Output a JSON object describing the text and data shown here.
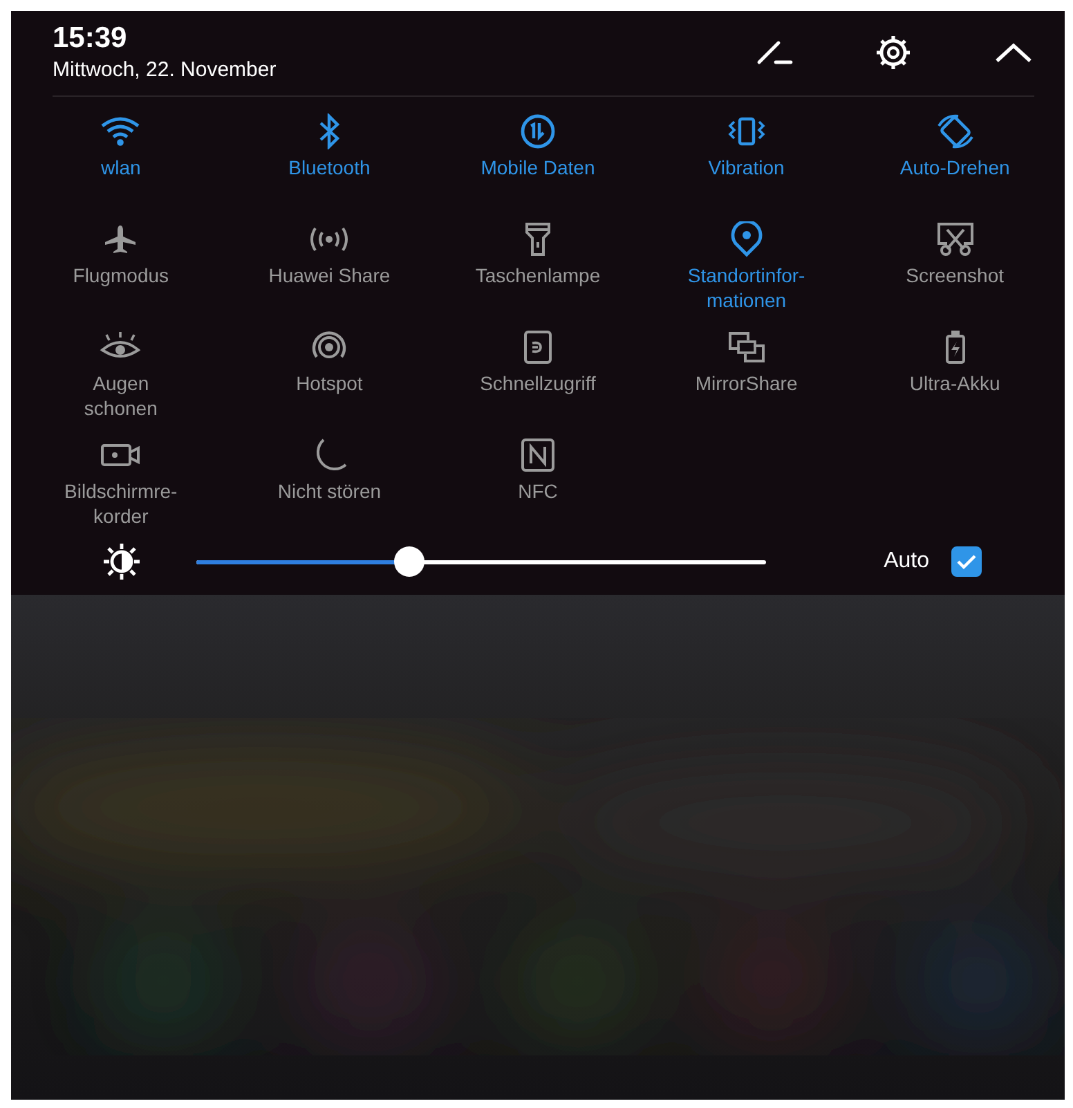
{
  "header": {
    "time": "15:39",
    "date": "Mittwoch, 22. November"
  },
  "tiles": [
    {
      "kind": "wifi",
      "label": "wlan",
      "on": true
    },
    {
      "kind": "bluetooth",
      "label": "Bluetooth",
      "on": true
    },
    {
      "kind": "data",
      "label": "Mobile Daten",
      "on": true
    },
    {
      "kind": "vibration",
      "label": "Vibration",
      "on": true
    },
    {
      "kind": "rotate",
      "label": "Auto-Drehen",
      "on": true
    },
    {
      "kind": "airplane",
      "label": "Flugmodus",
      "on": false
    },
    {
      "kind": "share",
      "label": "Huawei Share",
      "on": false
    },
    {
      "kind": "flashlight",
      "label": "Taschenlampe",
      "on": false
    },
    {
      "kind": "location",
      "label": "Standortinfor-\nmationen",
      "on": true
    },
    {
      "kind": "screenshot",
      "label": "Screenshot",
      "on": false
    },
    {
      "kind": "eye",
      "label": "Augen\nschonen",
      "on": false
    },
    {
      "kind": "hotspot",
      "label": "Hotspot",
      "on": false
    },
    {
      "kind": "quick",
      "label": "Schnellzugriff",
      "on": false
    },
    {
      "kind": "mirror",
      "label": "MirrorShare",
      "on": false
    },
    {
      "kind": "battery",
      "label": "Ultra-Akku",
      "on": false
    },
    {
      "kind": "recorder",
      "label": "Bildschirmre-\nkorder",
      "on": false
    },
    {
      "kind": "moon",
      "label": "Nicht stören",
      "on": false
    },
    {
      "kind": "nfc",
      "label": "NFC",
      "on": false
    }
  ],
  "brightness": {
    "level": 0.355,
    "auto_label": "Auto",
    "auto_checked": true
  }
}
